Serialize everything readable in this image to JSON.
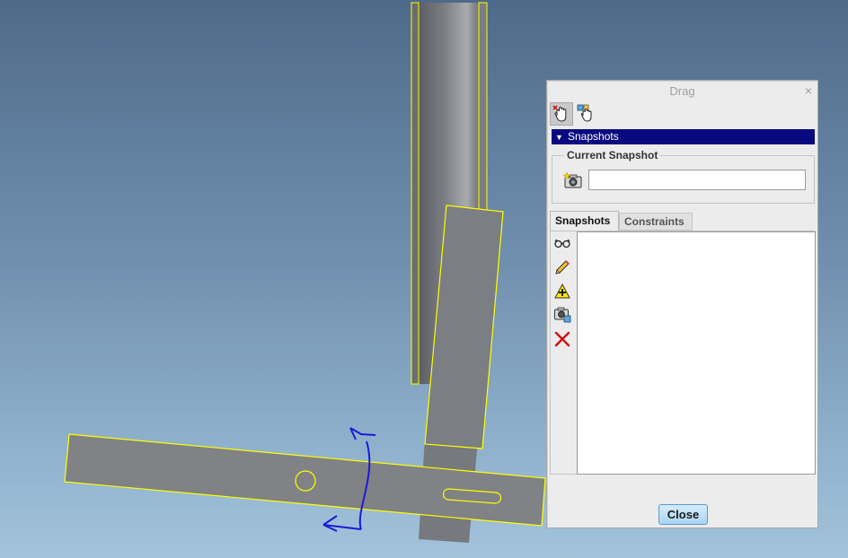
{
  "dialog": {
    "title": "Drag",
    "close_x": "×",
    "tools": [
      {
        "icon": "drag-hand-icon",
        "active": true
      },
      {
        "icon": "drag-component-icon",
        "active": false
      }
    ],
    "section_header": "Snapshots",
    "group_label": "Current Snapshot",
    "snapshot_name": "",
    "tabs": [
      "Snapshots",
      "Constraints"
    ],
    "side_icons": [
      "view-snapshot-icon",
      "edit-snapshot-icon",
      "add-snapshot-icon",
      "camera-snapshot-icon",
      "delete-snapshot-icon"
    ],
    "snapshot_list": [],
    "close_label": "Close"
  },
  "colors": {
    "part_fill": "#808286",
    "highlight": "#ffff00",
    "drag_arrow": "#1a1ad4",
    "header_bg": "#0a0a80"
  }
}
